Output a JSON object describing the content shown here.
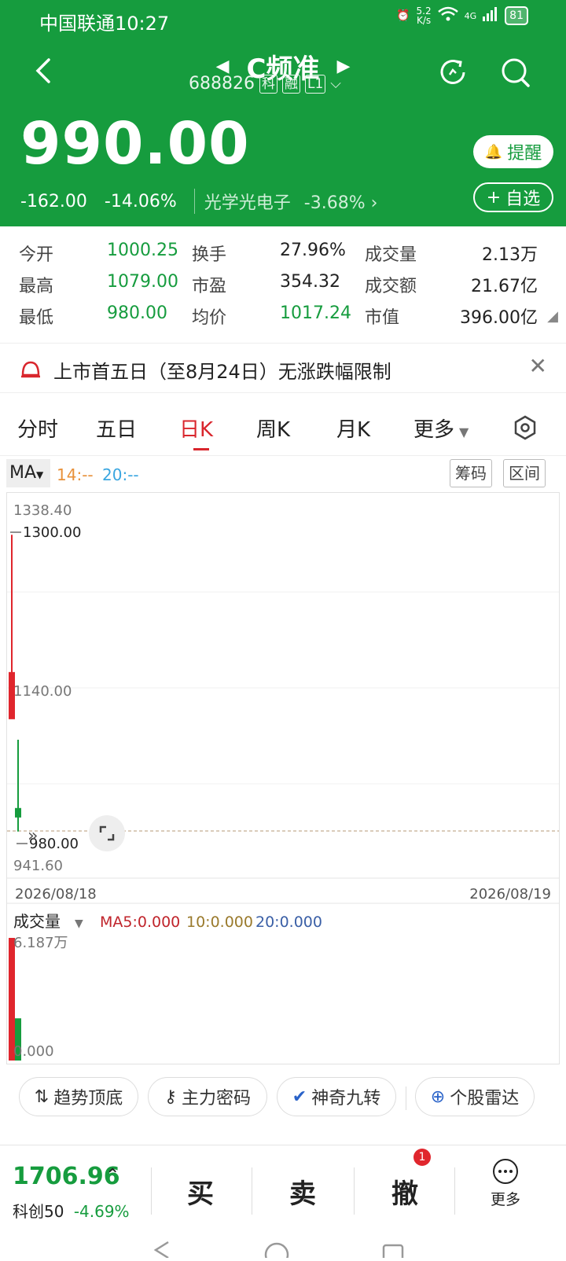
{
  "status": {
    "carrier_time": "中国联通10:27",
    "speed_value": "5.2",
    "speed_unit": "K/s",
    "network": "4G",
    "battery": "81"
  },
  "header": {
    "title": "C频准",
    "code": "688826",
    "tags": [
      "科",
      "融",
      "L1"
    ],
    "price": "990.00",
    "change": "-162.00",
    "change_pct": "-14.06%",
    "sector_name": "光学光电子",
    "sector_pct": "-3.68%",
    "alert_label": "提醒",
    "watchlist_label": "自选"
  },
  "quote": {
    "open_label": "今开",
    "open": "1000.25",
    "high_label": "最高",
    "high": "1079.00",
    "low_label": "最低",
    "low": "980.00",
    "turnover_label": "换手",
    "turnover": "27.96%",
    "pe_label": "市盈",
    "pe": "354.32",
    "avg_label": "均价",
    "avg": "1017.24",
    "volume_label": "成交量",
    "volume": "2.13万",
    "amount_label": "成交额",
    "amount": "21.67亿",
    "mktcap_label": "市值",
    "mktcap": "396.00亿"
  },
  "notice": {
    "text": "上市首五日（至8月24日）无涨跌幅限制"
  },
  "tabs": {
    "t1": "分时",
    "t2": "五日",
    "t3": "日K",
    "t4": "周K",
    "t5": "月K",
    "t6": "更多"
  },
  "toolbar": {
    "ma_label": "MA",
    "ma14": "14:--",
    "ma20": "20:--",
    "chip_label": "筹码",
    "range_label": "区间"
  },
  "chart": {
    "y_top": "1338.40",
    "y_max_label": "1300.00",
    "y_mid": "1140.00",
    "y_min_label": "980.00",
    "y_bottom": "941.60",
    "date_start": "2026/08/18",
    "date_end": "2026/08/19",
    "vol_label": "成交量",
    "vol_ma5": "MA5:0.000",
    "vol_ma10": "10:0.000",
    "vol_ma20": "20:0.000",
    "vol_top": "6.187万",
    "vol_zero": "0.000"
  },
  "chart_data": {
    "type": "candlestick",
    "categories": [
      "2026/08/18",
      "2026/08/19"
    ],
    "price_range": [
      941.6,
      1338.4
    ],
    "candles": [
      {
        "date": "2026/08/18",
        "open": 1140.0,
        "high": 1300.0,
        "low": 1140.0,
        "close": 1152.0,
        "direction": "up"
      },
      {
        "date": "2026/08/19",
        "open": 1000.25,
        "high": 1079.0,
        "low": 980.0,
        "close": 990.0,
        "direction": "down"
      }
    ],
    "volume_range": [
      0,
      6.187
    ],
    "volume_unit": "万",
    "volumes": [
      6.187,
      2.13
    ],
    "colors": {
      "up": "#e0262d",
      "down": "#169c3e"
    }
  },
  "indicators": [
    "趋势顶底",
    "主力密码",
    "神奇九转",
    "个股雷达"
  ],
  "bottom": {
    "index_value": "1706.96",
    "index_name": "科创50",
    "index_pct": "-4.69%",
    "buy": "买",
    "sell": "卖",
    "cancel": "撤",
    "cancel_badge": "1",
    "more": "更多"
  }
}
